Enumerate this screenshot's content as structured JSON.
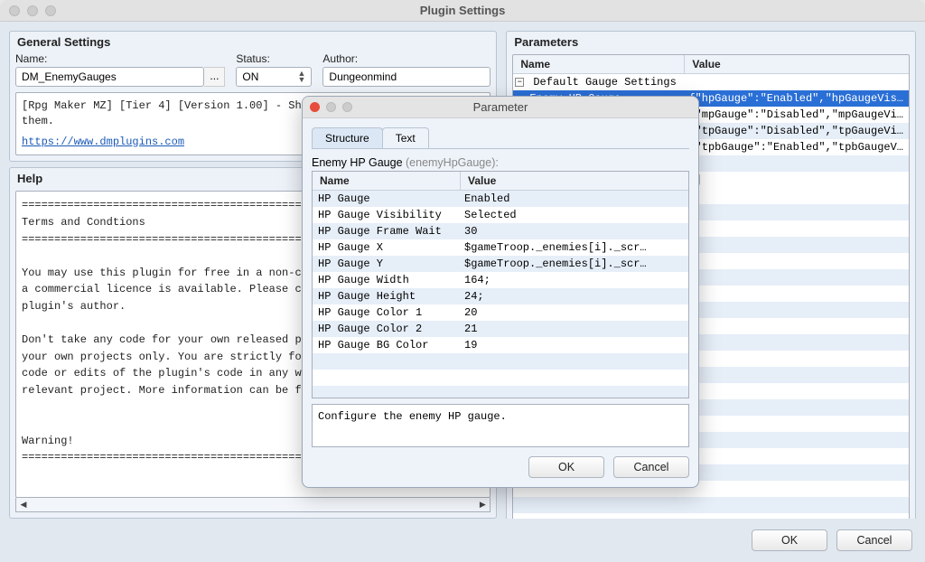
{
  "window": {
    "title": "Plugin Settings"
  },
  "general": {
    "heading": "General Settings",
    "name_label": "Name:",
    "name_value": "DM_EnemyGauges",
    "ell": "...",
    "status_label": "Status:",
    "status_value": "ON",
    "author_label": "Author:",
    "author_value": "Dungeonmind",
    "desc_line1": "[Rpg Maker MZ] [Tier 4] [Version 1.00] - Sho",
    "desc_line2": "them.",
    "desc_link": "https://www.dmplugins.com"
  },
  "help": {
    "heading": "Help",
    "text": "============================================\nTerms and Condtions\n============================================\n\nYou may use this plugin for free in a non-co\na commercial licence is available. Please co\nplugin's author.\n\nDon't take any code for your own released pl\nyour own projects only. You are strictly for\ncode or edits of the plugin's code in any wa\nrelevant project. More information can be fo\n\n\nWarning!\n============================================"
  },
  "parameters": {
    "heading": "Parameters",
    "col_name": "Name",
    "col_value": "Value",
    "group": "Default Gauge Settings",
    "rows": [
      {
        "name": "  Enemy HP Gauge",
        "value": "{\"hpGauge\":\"Enabled\",\"hpGaugeVis…",
        "sel": true
      },
      {
        "name": "",
        "value": "{\"mpGauge\":\"Disabled\",\"mpGaugeVi…"
      },
      {
        "name": "",
        "value": "{\"tpGauge\":\"Disabled\",\"tpGaugeVi…"
      },
      {
        "name": "",
        "value": "{\"tpbGauge\":\"Enabled\",\"tpbGaugeV…"
      },
      {
        "name": "",
        "value": ""
      },
      {
        "name": "",
        "value": "[]"
      }
    ]
  },
  "footer": {
    "ok": "OK",
    "cancel": "Cancel"
  },
  "modal": {
    "title": "Parameter",
    "tab_structure": "Structure",
    "tab_text": "Text",
    "label_main": "Enemy HP Gauge",
    "label_id": " (enemyHpGauge):",
    "col_name": "Name",
    "col_value": "Value",
    "rows": [
      {
        "name": "HP Gauge",
        "value": "Enabled"
      },
      {
        "name": "HP Gauge Visibility",
        "value": "Selected"
      },
      {
        "name": "HP Gauge Frame Wait",
        "value": "30"
      },
      {
        "name": "HP Gauge X",
        "value": "$gameTroop._enemies[i]._scr…"
      },
      {
        "name": "HP Gauge Y",
        "value": "$gameTroop._enemies[i]._scr…"
      },
      {
        "name": "HP Gauge Width",
        "value": "164;"
      },
      {
        "name": "HP Gauge Height",
        "value": "24;"
      },
      {
        "name": "HP Gauge Color 1",
        "value": "20"
      },
      {
        "name": "HP Gauge Color 2",
        "value": "21"
      },
      {
        "name": "HP Gauge BG Color",
        "value": "19"
      }
    ],
    "description": "Configure the enemy HP gauge.",
    "ok": "OK",
    "cancel": "Cancel"
  }
}
